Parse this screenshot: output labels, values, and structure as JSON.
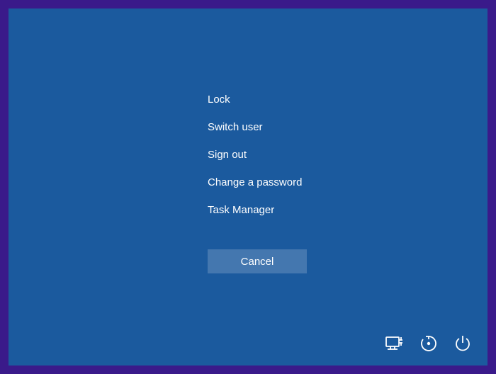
{
  "options": {
    "lock": "Lock",
    "switch_user": "Switch user",
    "sign_out": "Sign out",
    "change_password": "Change a password",
    "task_manager": "Task Manager"
  },
  "cancel_label": "Cancel",
  "icons": {
    "network": "network-icon",
    "ease_of_access": "ease-of-access-icon",
    "power": "power-icon"
  }
}
